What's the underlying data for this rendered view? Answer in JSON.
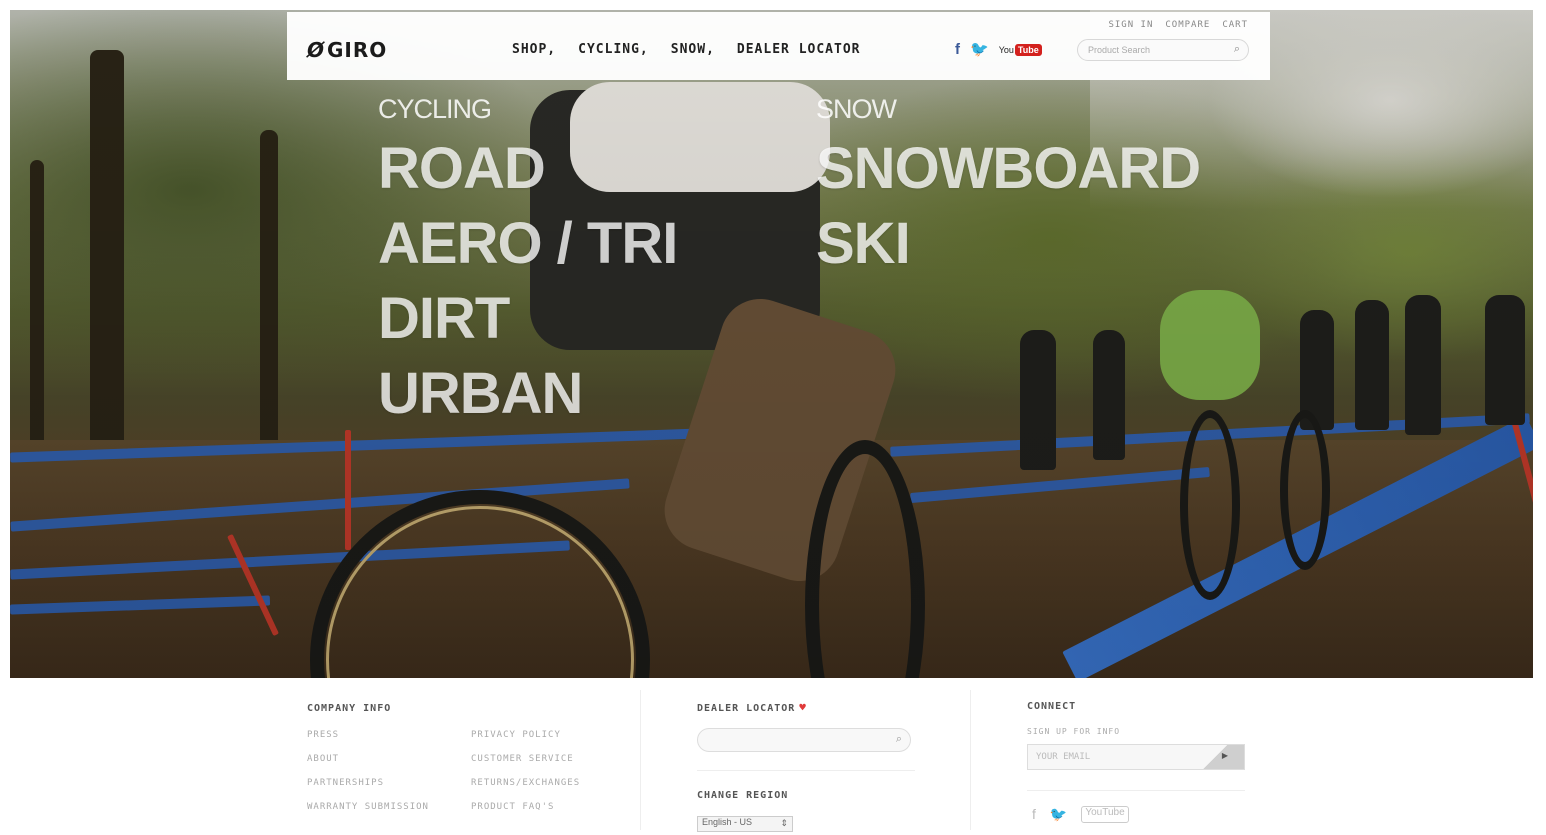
{
  "nav": {
    "logo": "GIRO",
    "menu": [
      "SHOP,",
      "CYCLING,",
      "SNOW,",
      "DEALER LOCATOR"
    ],
    "util": [
      "SIGN IN",
      "COMPARE",
      "CART"
    ],
    "search_placeholder": "Product Search",
    "social": {
      "facebook": "f",
      "twitter": "🐦",
      "youtube_you": "You",
      "youtube_tube": "Tube"
    }
  },
  "hero": {
    "cycling_head": "CYCLING",
    "cycling_links": [
      "ROAD",
      "AERO / TRI",
      "DIRT",
      "URBAN"
    ],
    "snow_head": "SNOW",
    "snow_links": [
      "SNOWBOARD",
      "SKI"
    ]
  },
  "footer": {
    "company": {
      "heading": "COMPANY INFO",
      "col1": [
        "PRESS",
        "ABOUT",
        "PARTNERSHIPS",
        "WARRANTY SUBMISSION"
      ],
      "col2": [
        "PRIVACY POLICY",
        "CUSTOMER SERVICE",
        "RETURNS/EXCHANGES",
        "PRODUCT FAQ'S"
      ]
    },
    "dealer": {
      "heading": "DEALER LOCATOR",
      "region_heading": "CHANGE REGION",
      "region_value": "English - US"
    },
    "connect": {
      "heading": "CONNECT",
      "signup": "SIGN UP FOR INFO",
      "email_placeholder": "YOUR EMAIL"
    }
  },
  "icons": {
    "search": "search-icon",
    "pin": "map-pin-icon",
    "facebook": "facebook-icon",
    "twitter": "twitter-icon",
    "youtube": "youtube-icon"
  }
}
